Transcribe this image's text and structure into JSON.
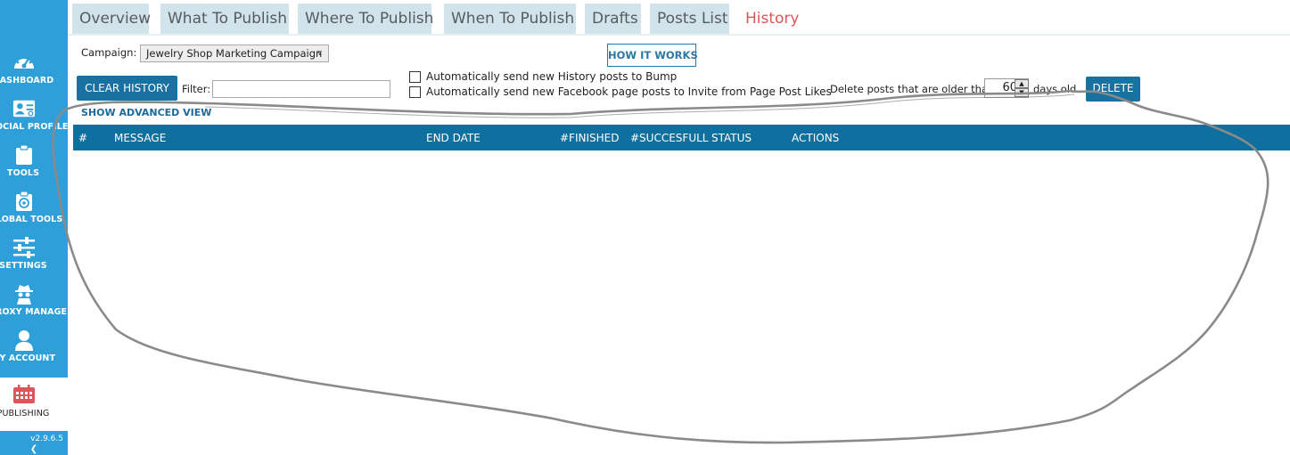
{
  "sidebar": {
    "items": [
      {
        "label": "DASHBOARD",
        "icon": "dashboard-gauge-icon"
      },
      {
        "label": "SOCIAL PROFILES",
        "icon": "profile-card-icon"
      },
      {
        "label": "TOOLS",
        "icon": "clipboard-icon"
      },
      {
        "label": "GLOBAL TOOLS",
        "icon": "global-tools-icon"
      },
      {
        "label": "SETTINGS",
        "icon": "sliders-icon"
      },
      {
        "label": "PROXY MANAGER",
        "icon": "spy-icon"
      },
      {
        "label": "MY ACCOUNT",
        "icon": "user-icon"
      },
      {
        "label": "PUBLISHING",
        "icon": "calendar-icon"
      }
    ],
    "active_index": 7,
    "version": "v2.9.6.5"
  },
  "tabs": [
    {
      "label": "Overview"
    },
    {
      "label": "What To Publish"
    },
    {
      "label": "Where To Publish"
    },
    {
      "label": "When To Publish"
    },
    {
      "label": "Drafts"
    },
    {
      "label": "Posts List"
    },
    {
      "label": "History"
    }
  ],
  "active_tab": "History",
  "toolbar": {
    "campaign_label": "Campaign:",
    "campaign_value": "Jewelry Shop Marketing Campaign",
    "how_it_works": "HOW IT WORKS",
    "clear_history": "CLEAR HISTORY",
    "filter_label": "Filter:",
    "filter_value": "",
    "checkbox_bump": "Automatically send new History posts to Bump",
    "checkbox_bump_checked": false,
    "checkbox_invite": "Automatically send new Facebook page posts to Invite from Page Post Likes",
    "checkbox_invite_checked": false,
    "delete_prefix": "Delete posts that are older than",
    "delete_days": "60",
    "delete_suffix": "days old",
    "delete_button": "DELETE",
    "advanced_link": "SHOW ADVANCED VIEW"
  },
  "table": {
    "columns": [
      "#",
      "MESSAGE",
      "END DATE",
      "#FINISHED",
      "#SUCCESFULL",
      "STATUS",
      "ACTIONS"
    ],
    "rows": []
  },
  "colors": {
    "sidebar": "#2e9fd8",
    "tab_bg": "#d1e4eb",
    "tab_active_text": "#e0555a",
    "primary_button": "#1871a1",
    "table_header": "#0f6f9f"
  }
}
